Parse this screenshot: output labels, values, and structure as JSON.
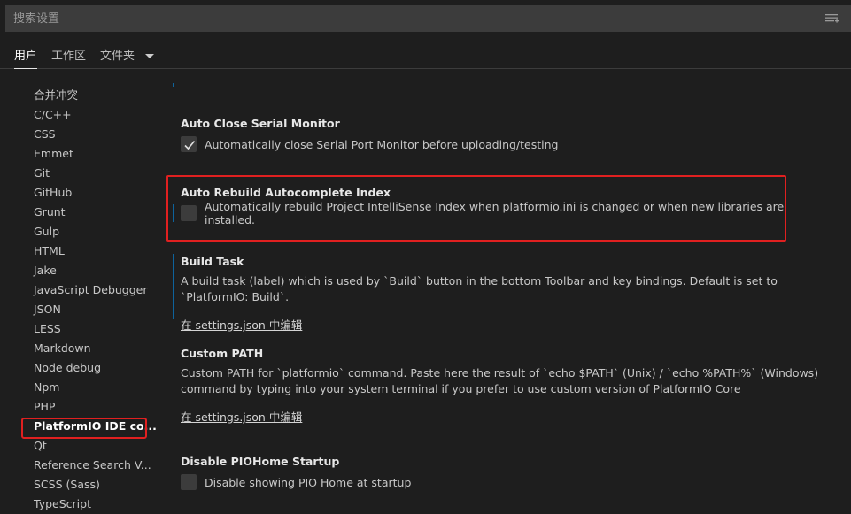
{
  "search": {
    "placeholder": "搜索设置"
  },
  "tabs": [
    {
      "label": "用户",
      "active": true
    },
    {
      "label": "工作区",
      "active": false
    },
    {
      "label": "文件夹",
      "active": false
    }
  ],
  "sidebar": {
    "items": [
      {
        "label": "合并冲突"
      },
      {
        "label": "C/C++"
      },
      {
        "label": "CSS"
      },
      {
        "label": "Emmet"
      },
      {
        "label": "Git"
      },
      {
        "label": "GitHub"
      },
      {
        "label": "Grunt"
      },
      {
        "label": "Gulp"
      },
      {
        "label": "HTML"
      },
      {
        "label": "Jake"
      },
      {
        "label": "JavaScript Debugger"
      },
      {
        "label": "JSON"
      },
      {
        "label": "LESS"
      },
      {
        "label": "Markdown"
      },
      {
        "label": "Node debug"
      },
      {
        "label": "Npm"
      },
      {
        "label": "PHP"
      },
      {
        "label": "PlatformIO IDE co..."
      },
      {
        "label": "Qt"
      },
      {
        "label": "Reference Search V..."
      },
      {
        "label": "SCSS (Sass)"
      },
      {
        "label": "TypeScript"
      }
    ],
    "selected_index": 17
  },
  "settings": {
    "auto_close": {
      "title": "Auto Close Serial Monitor",
      "checkbox_label": "Automatically close Serial Port Monitor before uploading/testing",
      "checked": true
    },
    "auto_rebuild": {
      "title": "Auto Rebuild Autocomplete Index",
      "checkbox_label": "Automatically rebuild Project IntelliSense Index when platformio.ini is changed or when new libraries are installed.",
      "checked": false
    },
    "build_task": {
      "title": "Build Task",
      "description": "A build task (label) which is used by `Build` button in the bottom Toolbar and key bindings. Default is set to `PlatformIO: Build`.",
      "edit_link": "在 settings.json 中编辑"
    },
    "custom_path": {
      "title": "Custom PATH",
      "description": "Custom PATH for `platformio` command. Paste here the result of `echo $PATH` (Unix) / `echo %PATH%` (Windows) command by typing into your system terminal if you prefer to use custom version of PlatformIO Core",
      "edit_link": "在 settings.json 中编辑"
    },
    "disable_piohome": {
      "title": "Disable PIOHome Startup",
      "checkbox_label": "Disable showing PIO Home at startup",
      "checked": false
    }
  },
  "colors": {
    "highlight": "#e02020",
    "accent": "#0e639c",
    "background": "#1e1e1e"
  }
}
